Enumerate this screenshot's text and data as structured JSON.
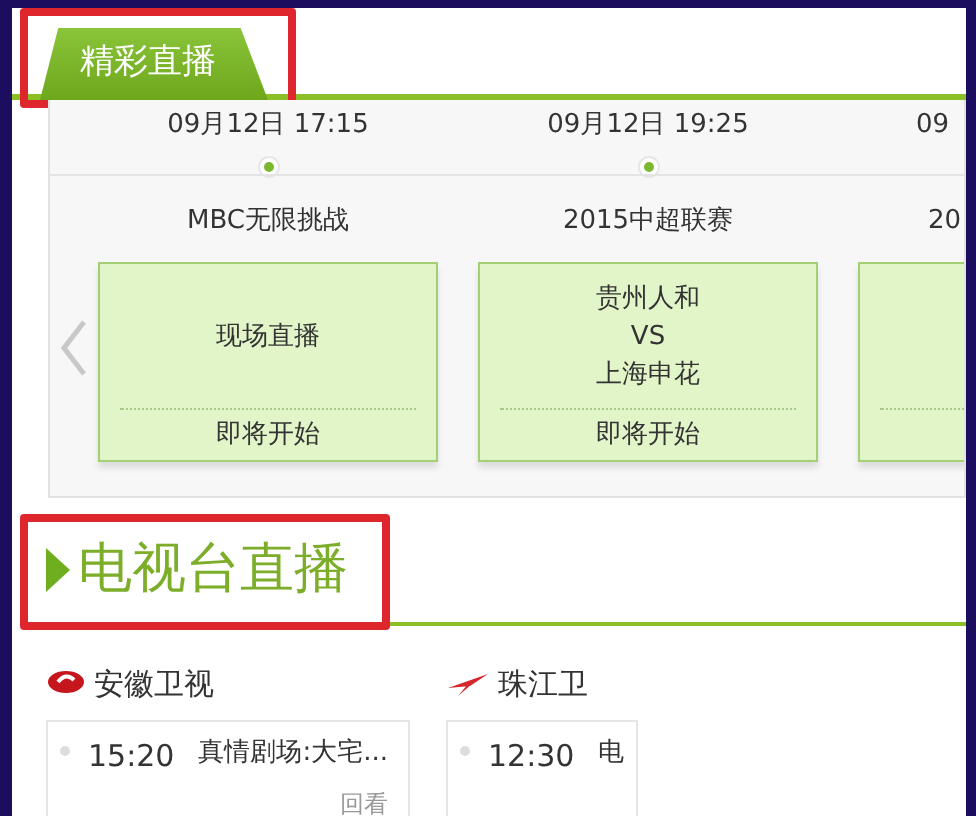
{
  "live_section": {
    "title": "精彩直播",
    "items": [
      {
        "kind": "full",
        "date": "09月12日 17:15",
        "title": "MBC无限挑战",
        "lines": [
          "现场直播"
        ],
        "status": "即将开始"
      },
      {
        "kind": "full",
        "date": "09月12日 19:25",
        "title": "2015中超联赛",
        "lines": [
          "贵州人和",
          "VS",
          "上海申花"
        ],
        "status": "即将开始"
      },
      {
        "kind": "partial",
        "date": "09",
        "title": "20"
      }
    ]
  },
  "tv_section": {
    "title": "电视台直播",
    "channels": [
      {
        "name": "安徽卫视",
        "kind": "oval",
        "programs": [
          {
            "time": "15:20",
            "title": "真情剧场:大宅...",
            "replay": "回看"
          }
        ]
      },
      {
        "name": "珠江卫",
        "kind": "swoosh",
        "programs": [
          {
            "time": "12:30",
            "title": "电"
          }
        ]
      }
    ]
  }
}
